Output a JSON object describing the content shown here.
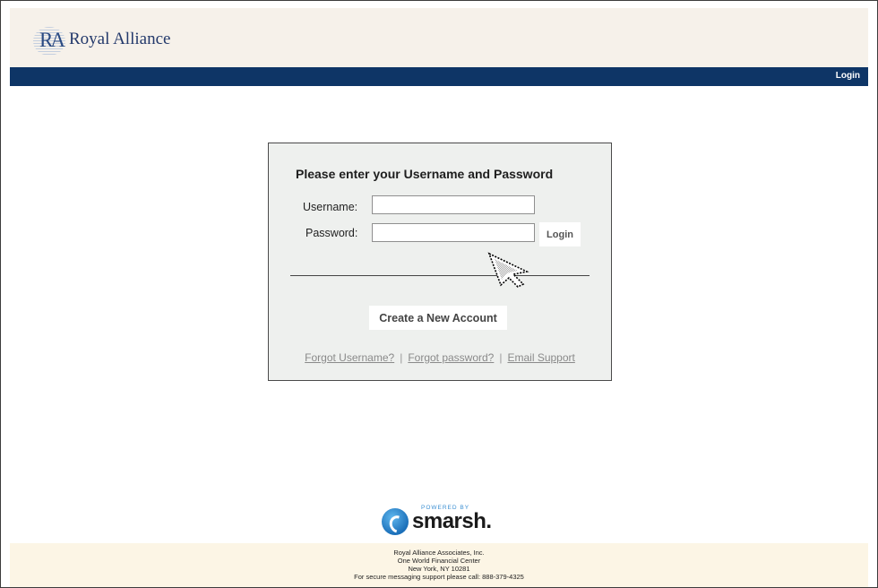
{
  "brand": {
    "logo_letters": "RA",
    "name": "Royal Alliance"
  },
  "navbar": {
    "login_label": "Login"
  },
  "login_form": {
    "title": "Please enter your Username and Password",
    "username_label": "Username:",
    "username_value": "",
    "password_label": "Password:",
    "password_value": "",
    "login_button": "Login",
    "create_account_button": "Create a New Account",
    "links": {
      "forgot_username": "Forgot Username?",
      "forgot_password": "Forgot password?",
      "email_support": "Email Support",
      "separator": "|"
    }
  },
  "powered_by": {
    "label": "POWERED BY",
    "brand": "smarsh",
    "dot": "."
  },
  "footer": {
    "lines": [
      "Royal Alliance Associates, Inc.",
      "One World Financial Center",
      "New York, NY 10281",
      "For secure messaging support please call: 888-379-4325"
    ]
  },
  "colors": {
    "header_bg": "#f6f1ea",
    "navbar_bg": "#0e3566",
    "panel_bg": "#eef0ee",
    "footer_bg": "#fcf5e5",
    "brand_text": "#23396b",
    "smarsh_blue": "#1b6fb9"
  },
  "icons": {
    "cursor": "mouse-pointer-icon",
    "smarsh_logo": "smarsh-swirl-icon",
    "brand_logo": "royal-alliance-monogram-icon"
  }
}
